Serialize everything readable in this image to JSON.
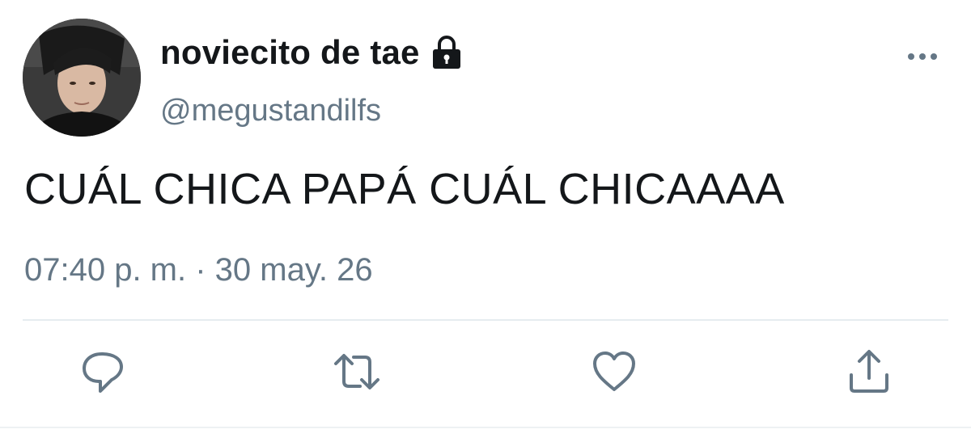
{
  "tweet": {
    "display_name": "noviecito de tae",
    "handle": "@megustandilfs",
    "text": "CUÁL CHICA PAPÁ CUÁL CHICAAAA",
    "timestamp": "07:40 p. m. · 30 may. 26",
    "protected_icon": "lock-icon",
    "menu_icon": "more-horizontal-icon"
  },
  "actions": [
    {
      "name": "reply",
      "icon": "reply-icon"
    },
    {
      "name": "retweet",
      "icon": "retweet-icon"
    },
    {
      "name": "like",
      "icon": "heart-icon"
    },
    {
      "name": "share",
      "icon": "share-icon"
    }
  ],
  "colors": {
    "text_primary": "#14171a",
    "text_secondary": "#657786",
    "icon": "#657786",
    "divider": "#e6ecf0"
  }
}
